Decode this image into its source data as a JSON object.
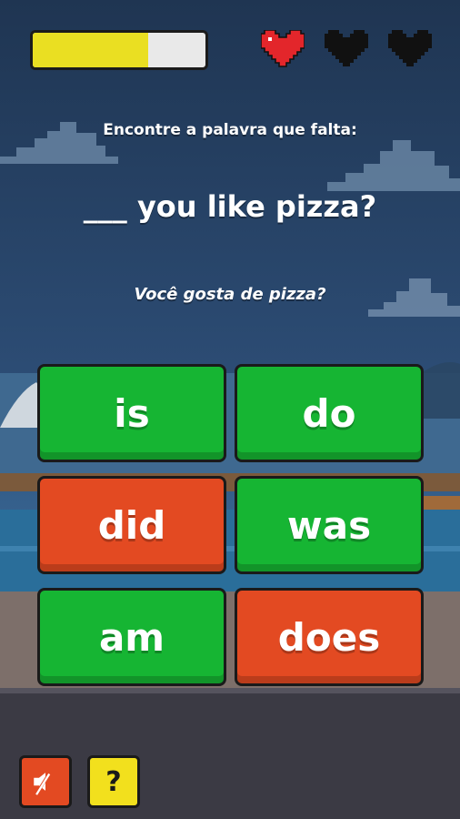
{
  "hud": {
    "progress": 0.67,
    "lives": [
      {
        "state": "full",
        "color": "#e3262b"
      },
      {
        "state": "empty",
        "color": "#111111"
      },
      {
        "state": "empty",
        "color": "#111111"
      }
    ]
  },
  "question": {
    "instruction": "Encontre a palavra que falta:",
    "sentence": "___ you like pizza?",
    "translation": "Você gosta de pizza?"
  },
  "answers": [
    {
      "label": "is",
      "state": "green"
    },
    {
      "label": "do",
      "state": "green"
    },
    {
      "label": "did",
      "state": "red"
    },
    {
      "label": "was",
      "state": "green"
    },
    {
      "label": "am",
      "state": "green"
    },
    {
      "label": "does",
      "state": "red"
    }
  ],
  "toolbar": {
    "mute_icon": "speaker-muted-icon",
    "help_label": "?"
  },
  "colors": {
    "green": "#16b533",
    "red": "#e34a22",
    "yellow": "#f2e01d",
    "progress_fill": "#eadf22"
  }
}
